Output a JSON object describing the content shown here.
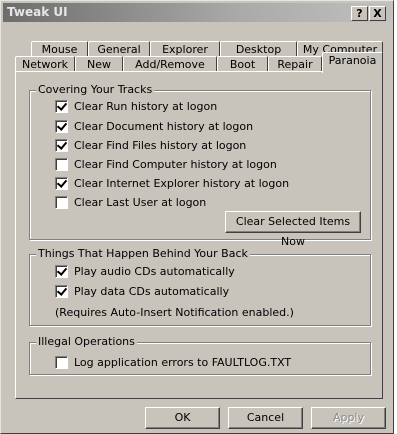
{
  "window": {
    "title": "Tweak UI",
    "help_button": "?",
    "close_button": "X"
  },
  "tabs_row1": [
    "Mouse",
    "General",
    "Explorer",
    "Desktop",
    "My Computer"
  ],
  "tabs_row2": [
    "Network",
    "New",
    "Add/Remove",
    "Boot",
    "Repair",
    "Paranoia"
  ],
  "active_tab": "Paranoia",
  "covering": {
    "label": "Covering Your Tracks",
    "items": [
      {
        "label": "Clear Run history at logon",
        "checked": true
      },
      {
        "label": "Clear Document history at logon",
        "checked": true
      },
      {
        "label": "Clear Find Files history at logon",
        "checked": true
      },
      {
        "label": "Clear Find Computer history at logon",
        "checked": false
      },
      {
        "label": "Clear Internet Explorer history at logon",
        "checked": true
      },
      {
        "label": "Clear Last User at logon",
        "checked": false
      }
    ],
    "clear_button": "Clear Selected Items Now"
  },
  "behind": {
    "label": "Things That Happen Behind Your Back",
    "items": [
      {
        "label": "Play audio CDs automatically",
        "checked": true
      },
      {
        "label": "Play data CDs automatically",
        "checked": true
      }
    ],
    "note": "(Requires Auto-Insert Notification enabled.)"
  },
  "illegal": {
    "label": "Illegal Operations",
    "items": [
      {
        "label": "Log application errors to FAULTLOG.TXT",
        "checked": false
      }
    ]
  },
  "footer": {
    "ok": "OK",
    "cancel": "Cancel",
    "apply": "Apply"
  }
}
